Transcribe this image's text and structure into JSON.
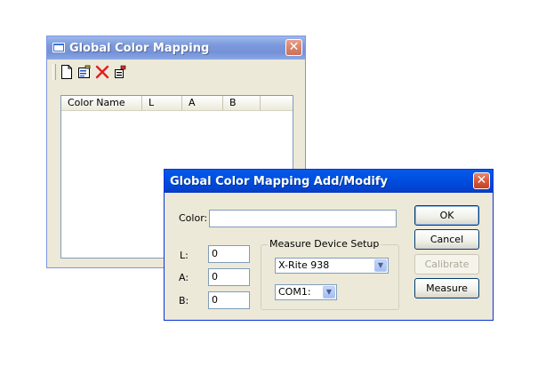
{
  "back_window": {
    "title": "Global Color Mapping",
    "close_glyph": "✕",
    "toolbar": {
      "icons": [
        "new-document-icon",
        "edit-properties-icon",
        "delete-x-icon",
        "assign-icon"
      ]
    },
    "list": {
      "columns": [
        "Color Name",
        "L",
        "A",
        "B"
      ]
    }
  },
  "dialog": {
    "title": "Global Color Mapping Add/Modify",
    "close_glyph": "✕",
    "color": {
      "label": "Color:",
      "value": ""
    },
    "l": {
      "label": "L:",
      "value": "0"
    },
    "a": {
      "label": "A:",
      "value": "0"
    },
    "b": {
      "label": "B:",
      "value": "0"
    },
    "measure_group": {
      "legend": "Measure Device Setup",
      "device": "X-Rite 938",
      "port": "COM1:"
    },
    "buttons": {
      "ok": "OK",
      "cancel": "Cancel",
      "calibrate": "Calibrate",
      "measure": "Measure"
    }
  },
  "colors": {
    "active_title": "#0054e3",
    "inactive_title": "#7a98dc",
    "dialog_bg": "#ece9d8",
    "delete_icon": "#e02020"
  }
}
